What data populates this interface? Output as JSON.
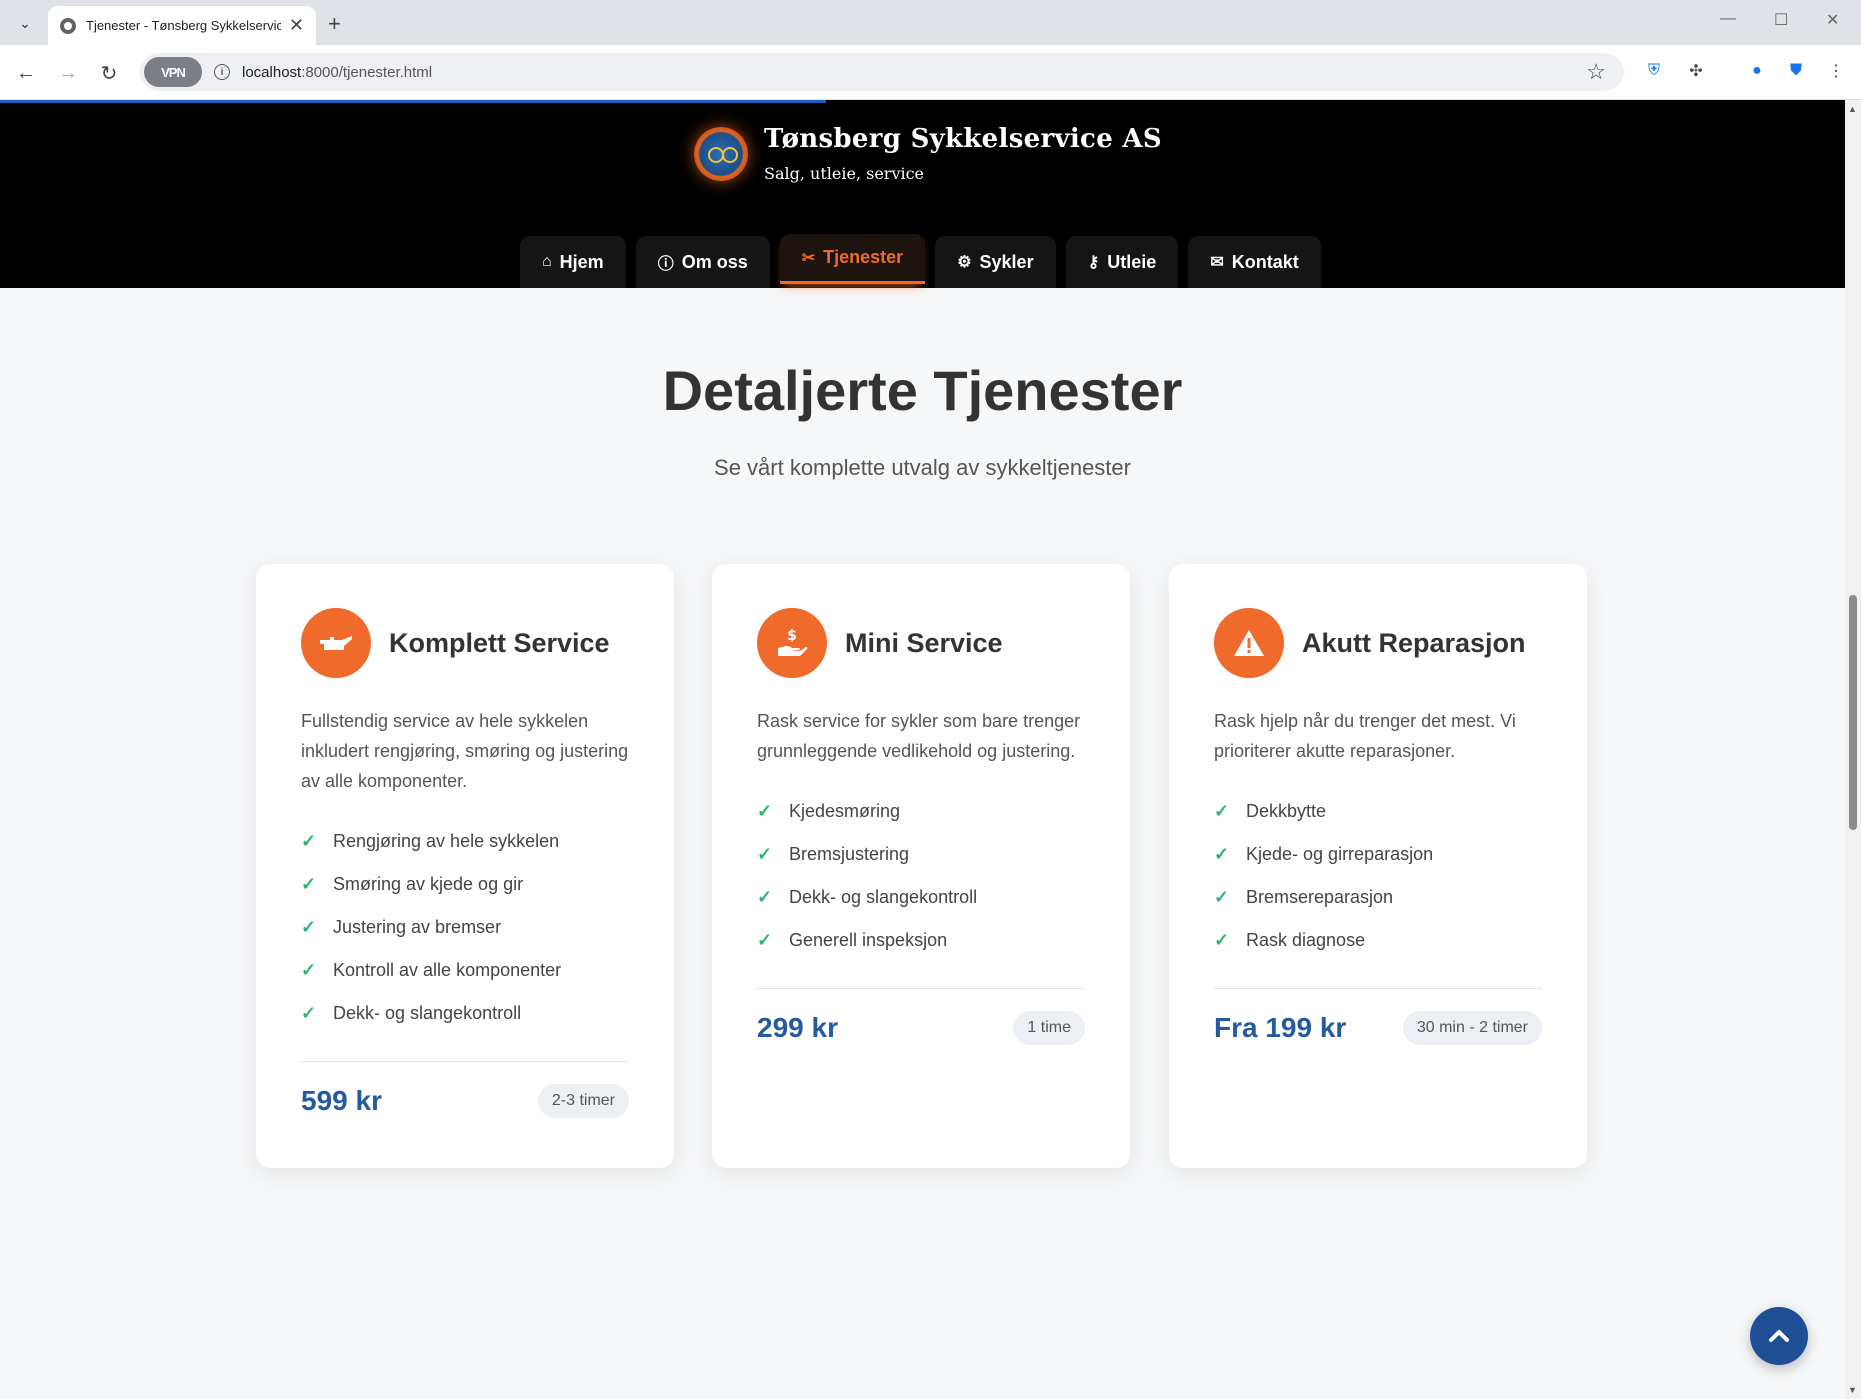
{
  "browser": {
    "tab_title": "Tjenester - Tønsberg Sykkelservice",
    "url_host": "localhost",
    "url_path": ":8000/tjenester.html",
    "vpn_label": "VPN"
  },
  "site": {
    "name": "Tønsberg Sykkelservice AS",
    "tagline": "Salg, utleie, service"
  },
  "nav": [
    {
      "label": "Hjem",
      "icon": "home-icon",
      "glyph": "⌂"
    },
    {
      "label": "Om oss",
      "icon": "info-icon",
      "glyph": "ℹ"
    },
    {
      "label": "Tjenester",
      "icon": "tools-icon",
      "glyph": "✂",
      "active": true
    },
    {
      "label": "Sykler",
      "icon": "bicycle-icon",
      "glyph": "⚙"
    },
    {
      "label": "Utleie",
      "icon": "key-icon",
      "glyph": "⚿"
    },
    {
      "label": "Kontakt",
      "icon": "envelope-icon",
      "glyph": "✉"
    }
  ],
  "hero": {
    "title": "Detaljerte Tjenester",
    "subtitle": "Se vårt komplette utvalg av sykkeltjenester"
  },
  "cards": [
    {
      "icon": "oil-can-icon",
      "title": "Komplett Service",
      "description": "Fullstendig service av hele sykkelen inkludert rengjøring, smøring og justering av alle komponenter.",
      "features": [
        "Rengjøring av hele sykkelen",
        "Smøring av kjede og gir",
        "Justering av bremser",
        "Kontroll av alle komponenter",
        "Dekk- og slangekontroll"
      ],
      "price": "599 kr",
      "duration": "2-3 timer"
    },
    {
      "icon": "hand-dollar-icon",
      "title": "Mini Service",
      "description": "Rask service for sykler som bare trenger grunnleggende vedlikehold og justering.",
      "features": [
        "Kjedesmøring",
        "Bremsjustering",
        "Dekk- og slangekontroll",
        "Generell inspeksjon"
      ],
      "price": "299 kr",
      "duration": "1 time"
    },
    {
      "icon": "warning-icon",
      "title": "Akutt Reparasjon",
      "description": "Rask hjelp når du trenger det mest. Vi prioriterer akutte reparasjoner.",
      "features": [
        "Dekkbytte",
        "Kjede- og girreparasjon",
        "Bremsereparasjon",
        "Rask diagnose"
      ],
      "price": "Fra 199 kr",
      "duration": "30 min - 2 timer"
    }
  ],
  "colors": {
    "accent": "#f06a2c",
    "price": "#245aa0",
    "check": "#2bb673",
    "header_bg": "#000000",
    "scroll_top_button": "#1e4f96"
  }
}
